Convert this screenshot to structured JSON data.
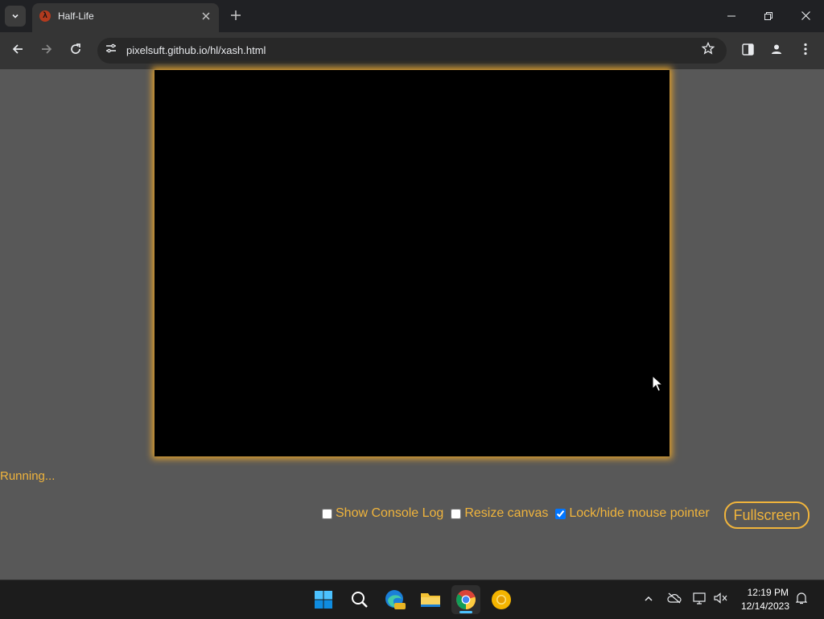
{
  "browser": {
    "tab": {
      "title": "Half-Life",
      "favicon_letter": "λ"
    },
    "url": "pixelsuft.github.io/hl/xash.html",
    "icons": {
      "tab_menu": "chevron-down-icon",
      "close_tab": "close-icon",
      "new_tab": "plus-icon",
      "back": "back-arrow-icon",
      "forward": "forward-arrow-icon",
      "reload": "reload-icon",
      "site_info": "site-settings-icon",
      "bookmark": "star-icon",
      "side_panel": "side-panel-icon",
      "profile": "profile-icon",
      "menu": "kebab-menu-icon"
    }
  },
  "page": {
    "status": "Running...",
    "options": [
      {
        "label": "Show Console Log",
        "checked": false
      },
      {
        "label": "Resize canvas",
        "checked": false
      },
      {
        "label": "Lock/hide mouse pointer",
        "checked": true
      }
    ],
    "fullscreen_label": "Fullscreen"
  },
  "taskbar": {
    "time": "12:19 PM",
    "date": "12/14/2023"
  },
  "colors": {
    "accent": "#f0b43c",
    "page_bg": "#585858",
    "canvas_glow": "#e2a12c"
  }
}
